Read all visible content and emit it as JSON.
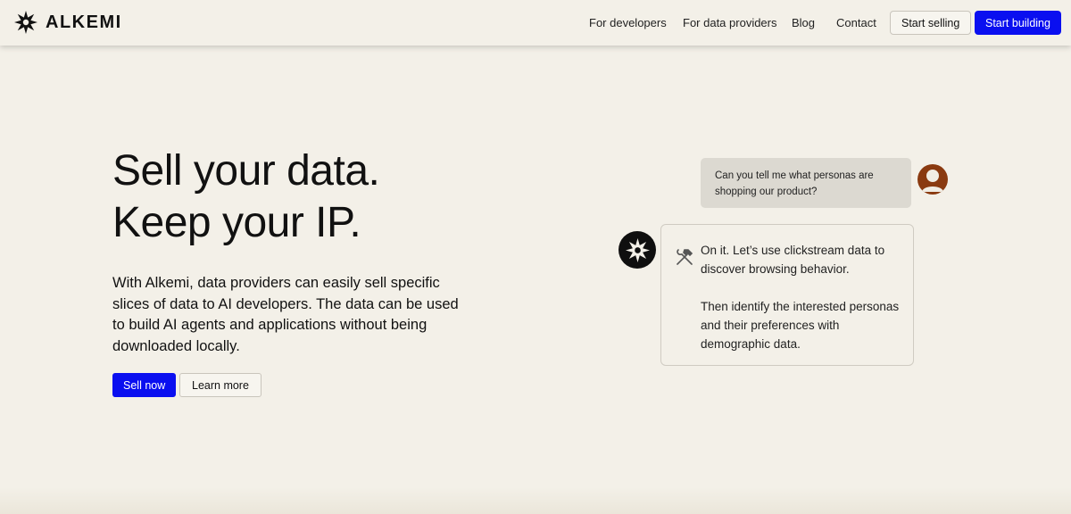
{
  "brand": {
    "name": "ALKEMI",
    "logo_icon": "star-burst-icon"
  },
  "nav": {
    "links": [
      "For developers",
      "For data providers",
      "Blog",
      "Contact"
    ],
    "start_selling": "Start selling",
    "start_building": "Start building"
  },
  "hero": {
    "title_line1": "Sell your data.",
    "title_line2": "Keep your IP.",
    "description": "With Alkemi, data providers can easily sell specific slices of data to AI developers. The data can be used to build AI agents and applications without being downloaded locally.",
    "primary_button": "Sell now",
    "secondary_button": "Learn more"
  },
  "chat": {
    "user_message": "Can you tell me what personas are shopping our product?",
    "bot_message_1": "On it. Let’s use clickstream data to discover browsing behavior.",
    "bot_message_2": "Then identify the interested personas and their preferences with demographic data.",
    "tool_icon": "hammer-wrench-icon"
  },
  "colors": {
    "background": "#f3f0e8",
    "accent_blue": "#0a0ff0",
    "avatar_brown": "#8a3a10",
    "user_bubble": "#dcd9d1"
  }
}
